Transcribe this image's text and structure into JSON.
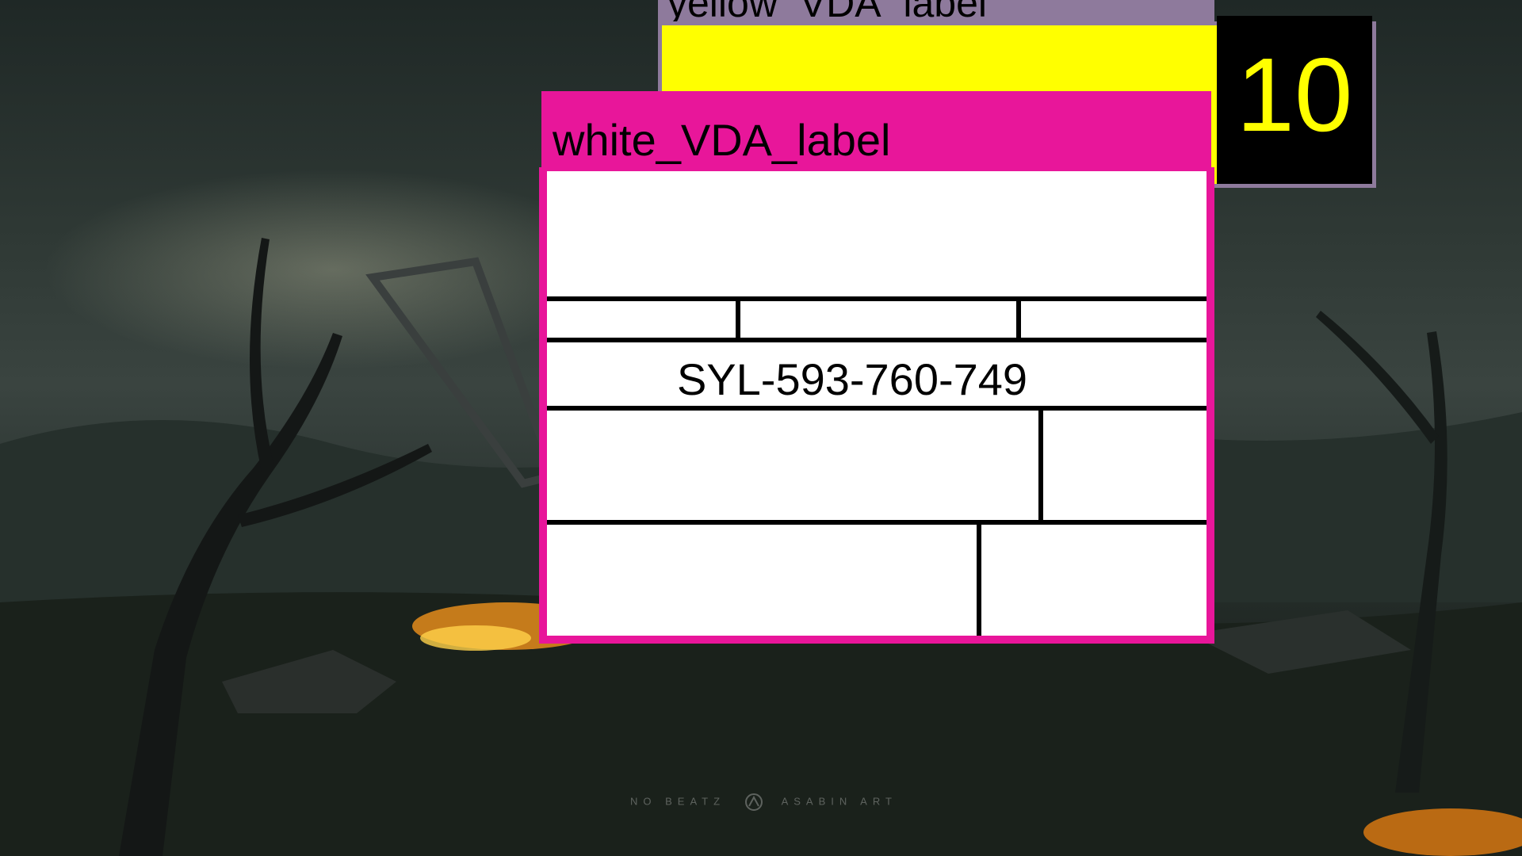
{
  "background": {
    "description_colors": {
      "sky": "#2f3935",
      "ground": "#141a15",
      "fire": "#ff8c14"
    },
    "watermark": {
      "left_text": "NO BEATZ",
      "right_text": "ASABIN ART"
    }
  },
  "yellow_window": {
    "title": "yellow_VDA_label",
    "count": "10",
    "colors": {
      "frame": "#8e7a9c",
      "fill": "#ffff00",
      "count_bg": "#000000",
      "count_text": "#ffff00"
    }
  },
  "white_window": {
    "title": "white_VDA_label",
    "serial": "SYL-593-760-749",
    "colors": {
      "frame": "#e8169a",
      "fill": "#ffffff",
      "lines": "#000000"
    }
  }
}
